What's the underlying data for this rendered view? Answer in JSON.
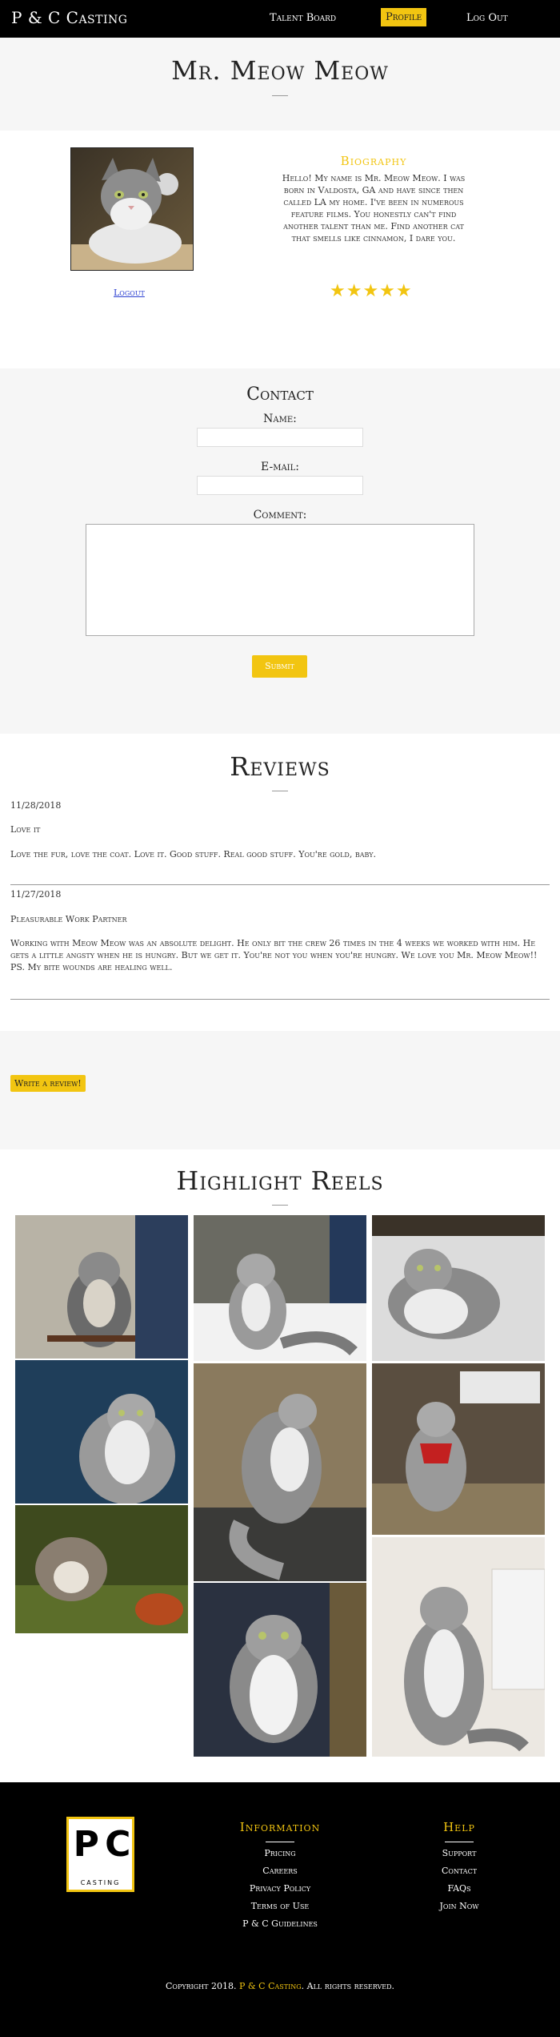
{
  "nav": {
    "brand": "P & C Casting",
    "talent_board": "Talent Board",
    "profile": "Profile",
    "logout": "Log Out"
  },
  "profile": {
    "name": "Mr. Meow Meow",
    "logout_link": "Logout",
    "bio_title": "Biography",
    "bio_text": "Hello! My name is Mr. Meow Meow. I was born in Valdosta, GA and have since then called LA my home. I've been in numerous feature films. You honestly can't find another talent than me. Find another cat that smells like cinnamon, I dare you.",
    "rating_stars": "★★★★★",
    "rating": 5
  },
  "contact": {
    "title": "Contact",
    "name_label": "Name:",
    "email_label": "E-mail:",
    "comment_label": "Comment:",
    "name_value": "",
    "email_value": "",
    "comment_value": "",
    "submit": "Submit"
  },
  "reviews": {
    "title": "Reviews",
    "items": [
      {
        "date": "11/28/2018",
        "title": "Love it",
        "body": "Love the fur, love the coat. Love it. Good stuff. Real good stuff. You're gold, baby."
      },
      {
        "date": "11/27/2018",
        "title": "Pleasurable Work Partner",
        "body": "Working with Meow Meow was an absolute delight. He only bit the crew 26 times in the 4 weeks we worked with him. He gets a little angsty when he is hungry. But we get it. You're not you when you're hungry. We love you Mr. Meow Meow!! PS. My bite wounds are healing well."
      }
    ],
    "write_button": "Write a review!"
  },
  "highlights": {
    "title": "Highlight Reels"
  },
  "footer": {
    "logo_letters": "P C",
    "logo_sub": "CASTING",
    "info_title": "Information",
    "info_items": [
      "Pricing",
      "Careers",
      "Privacy Policy",
      "Terms of Use",
      "P & C Guidelines"
    ],
    "help_title": "Help",
    "help_items": [
      "Support",
      "Contact",
      "FAQs",
      "Join Now"
    ],
    "copyright_pre": "Copyright 2018.",
    "copyright_brand": "P & C Casting",
    "copyright_post": ". All rights reserved."
  }
}
